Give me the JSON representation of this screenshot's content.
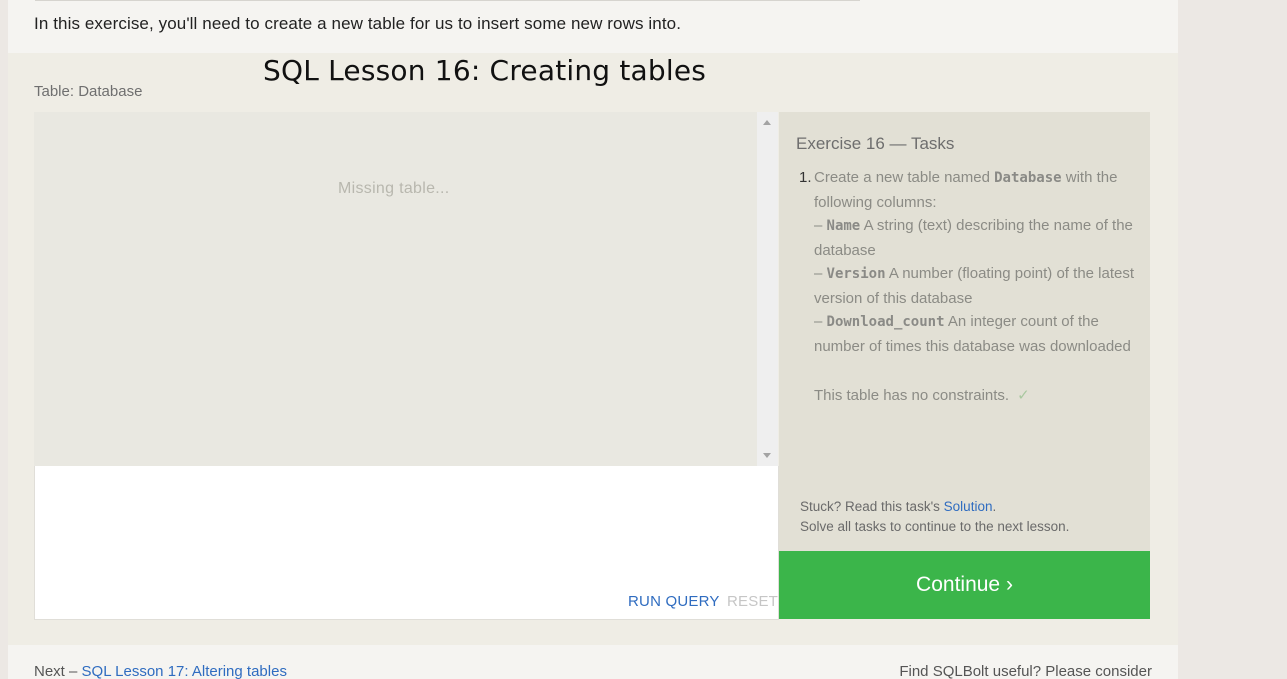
{
  "intro_text": "In this exercise, you'll need to create a new table for us to insert some new rows into.",
  "lesson_title": "SQL Lesson 16: Creating tables",
  "table_label": "Table: Database",
  "results": {
    "placeholder": "Missing table..."
  },
  "editor": {
    "run_label": "RUN QUERY",
    "reset_label": "RESET"
  },
  "tasks": {
    "title": "Exercise 16 — Tasks",
    "items": [
      {
        "number": "1.",
        "intro_before": "Create a new table named",
        "table_name": "Database",
        "intro_after": "with the following columns:",
        "columns": [
          {
            "dash": "–",
            "name": "Name",
            "description": "A string (text) describing the name of the database"
          },
          {
            "dash": "–",
            "name": "Version",
            "description": "A number (floating point) of the latest version of this database"
          },
          {
            "dash": "–",
            "name": "Download_count",
            "description": "An integer count of the number of times this database was downloaded"
          }
        ],
        "constraints": "This table has no constraints.",
        "check_icon": "✓"
      }
    ],
    "stuck_prefix": "Stuck? Read this task's",
    "solution_link": "Solution",
    "stuck_suffix": ".",
    "solve_all": "Solve all tasks to continue to the next lesson."
  },
  "continue_label": "Continue ›",
  "footer": {
    "next_prefix": "Next –",
    "next_link": "SQL Lesson 17: Altering tables",
    "find_text": "Find SQLBolt useful? Please consider"
  },
  "colors": {
    "accent_link": "#2f6cc0",
    "continue_bg": "#3bb54a"
  }
}
